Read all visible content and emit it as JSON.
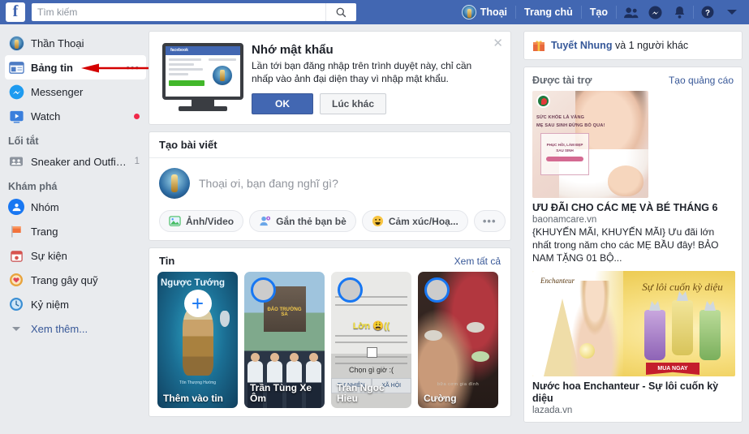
{
  "topbar": {
    "logo": "f",
    "search": {
      "placeholder": "Tìm kiếm",
      "value": "",
      "icon": "search-icon"
    },
    "profile_name": "Thoại",
    "home_label": "Trang chủ",
    "create_label": "Tạo",
    "icons": [
      "friend-requests-icon",
      "messenger-icon",
      "notifications-icon",
      "help-icon",
      "account-menu-icon"
    ],
    "brand_color": "#4267b2"
  },
  "sidebar": {
    "profile": {
      "label": "Thần Thoại",
      "icon": "profile-avatar"
    },
    "items": [
      {
        "label": "Bảng tin",
        "icon": "news-feed-icon",
        "trailing": "•••",
        "active": true
      },
      {
        "label": "Messenger",
        "icon": "messenger-icon",
        "trailing": ""
      },
      {
        "label": "Watch",
        "icon": "watch-icon",
        "trailing": "dot"
      }
    ],
    "shortcuts_heading": "Lối tắt",
    "shortcuts": [
      {
        "label": "Sneaker and Outfit ...",
        "icon": "group-icon",
        "count": "1"
      }
    ],
    "explore_heading": "Khám phá",
    "explore": [
      {
        "label": "Nhóm",
        "icon": "groups-icon"
      },
      {
        "label": "Trang",
        "icon": "pages-flag-icon"
      },
      {
        "label": "Sự kiện",
        "icon": "events-calendar-icon"
      },
      {
        "label": "Trang gây quỹ",
        "icon": "fundraiser-heart-icon"
      },
      {
        "label": "Kỷ niệm",
        "icon": "memories-clock-icon"
      }
    ],
    "see_more": "Xem thêm...",
    "annotation": {
      "type": "red-arrow",
      "color": "#d40000",
      "points_to": "Thần Thoại"
    }
  },
  "password_dialog": {
    "title": "Nhớ mật khẩu",
    "body": "Lần tới bạn đăng nhập trên trình duyệt này, chỉ cần nhấp vào ảnh đại diện thay vì nhập mật khẩu.",
    "ok_label": "OK",
    "later_label": "Lúc khác",
    "close_icon": "close-icon",
    "illustration": {
      "name": "monitor-illustration",
      "browser_label": "facebook"
    }
  },
  "composer": {
    "header": "Tạo bài viết",
    "placeholder": "Thoại ơi, bạn đang nghĩ gì?",
    "actions": [
      {
        "label": "Ảnh/Video",
        "icon": "photo-video-icon"
      },
      {
        "label": "Gắn thẻ bạn bè",
        "icon": "tag-friends-icon"
      },
      {
        "label": "Cảm xúc/Hoạ...",
        "icon": "feeling-activity-icon"
      },
      {
        "label": "•••",
        "icon": "more-options-icon"
      }
    ]
  },
  "stories": {
    "title": "Tin",
    "see_all": "Xem tất cả",
    "items": [
      {
        "name": "Thêm vào tin",
        "kind": "add",
        "art": "game",
        "art_title": "Ngược Tướng",
        "art_sub": "Tôn Thượng Hường"
      },
      {
        "name": "Trần Tùng Xe Ôm",
        "kind": "story",
        "art": "navy",
        "art_title": "ĐẢO TRƯỜNG SA"
      },
      {
        "name": "Tran Ngoc Hieu",
        "kind": "story",
        "art": "doc",
        "art_yellow": "Lờn 😩((",
        "art_question": "Chọn gì giờ :(",
        "tab_left": "TỰ NHIÊN",
        "tab_right": "XÃ HỘI"
      },
      {
        "name": "Cường",
        "kind": "story",
        "art": "dinner",
        "art_caption": "bữa cơm gia đình"
      }
    ]
  },
  "right": {
    "birthday": {
      "name": "Tuyết Nhung",
      "suffix": "và 1 người khác",
      "icon": "gift-icon"
    },
    "sponsored_title": "Được tài trợ",
    "create_ad": "Tạo quảng cáo",
    "ads": [
      {
        "title": "ƯU ĐÃI CHO CÁC MẸ VÀ BÉ THÁNG 6",
        "url": "baonamcare.vn",
        "desc": "{KHUYẾN MÃI, KHUYẾN MÃI} Ưu đãi lớn nhất trong năm cho các MẸ BẦU đây! BẢO NAM TẶNG 01 BỘ...",
        "art": "mother-baby",
        "art_line1": "SỨC KHỎE LÀ VÀNG",
        "art_line2": "MẸ SAU SINH ĐỪNG BỎ QUA!",
        "art_badge1": "PHỤC HỒI, LÀM ĐẸP",
        "art_badge2": "SAU SINH"
      },
      {
        "title": "Nước hoa Enchanteur - Sự lôi cuốn kỳ diệu",
        "url": "lazada.vn",
        "desc": "",
        "art": "perfume",
        "art_logo": "Enchanteur",
        "art_script": "Sự lôi cuốn kỳ diệu",
        "art_cta": "MUA NGAY"
      }
    ]
  }
}
